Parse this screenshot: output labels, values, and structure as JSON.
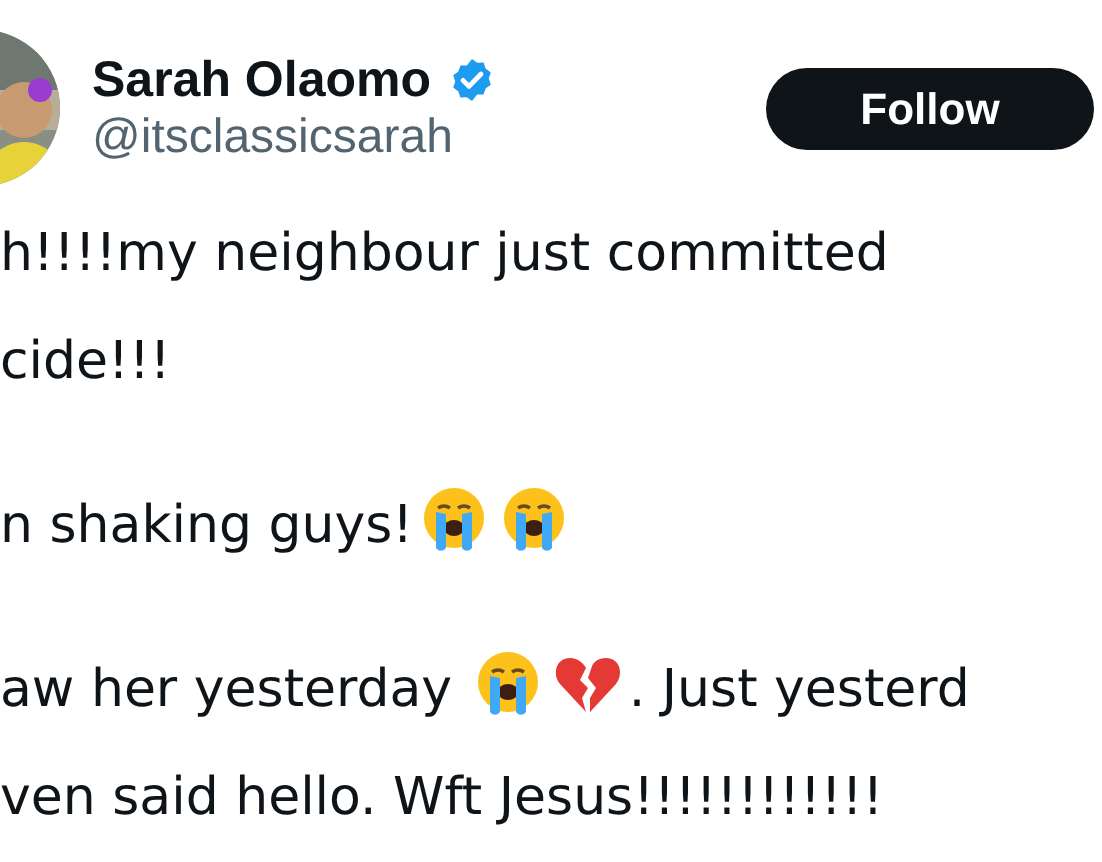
{
  "author": {
    "name": "Sarah Olaomo",
    "verified": true,
    "handle": "@itsclassicsarah"
  },
  "follow_button": {
    "label": "Follow"
  },
  "paragraphs": [
    [
      [
        {
          "kind": "text",
          "text": "h!!!!my neighbour just committed"
        }
      ],
      [
        {
          "kind": "text",
          "text": "cide!!!"
        }
      ]
    ],
    [
      [
        {
          "kind": "text",
          "text": "n shaking guys!"
        },
        {
          "kind": "crying-face"
        },
        {
          "kind": "crying-face"
        }
      ]
    ],
    [
      [
        {
          "kind": "text",
          "text": "aw her yesterday "
        },
        {
          "kind": "crying-face"
        },
        {
          "kind": "broken-heart"
        },
        {
          "kind": "text",
          "text": ". Just yesterd"
        }
      ],
      [
        {
          "kind": "text",
          "text": "ven said hello. Wft Jesus!!!!!!!!!!!!"
        }
      ]
    ]
  ]
}
